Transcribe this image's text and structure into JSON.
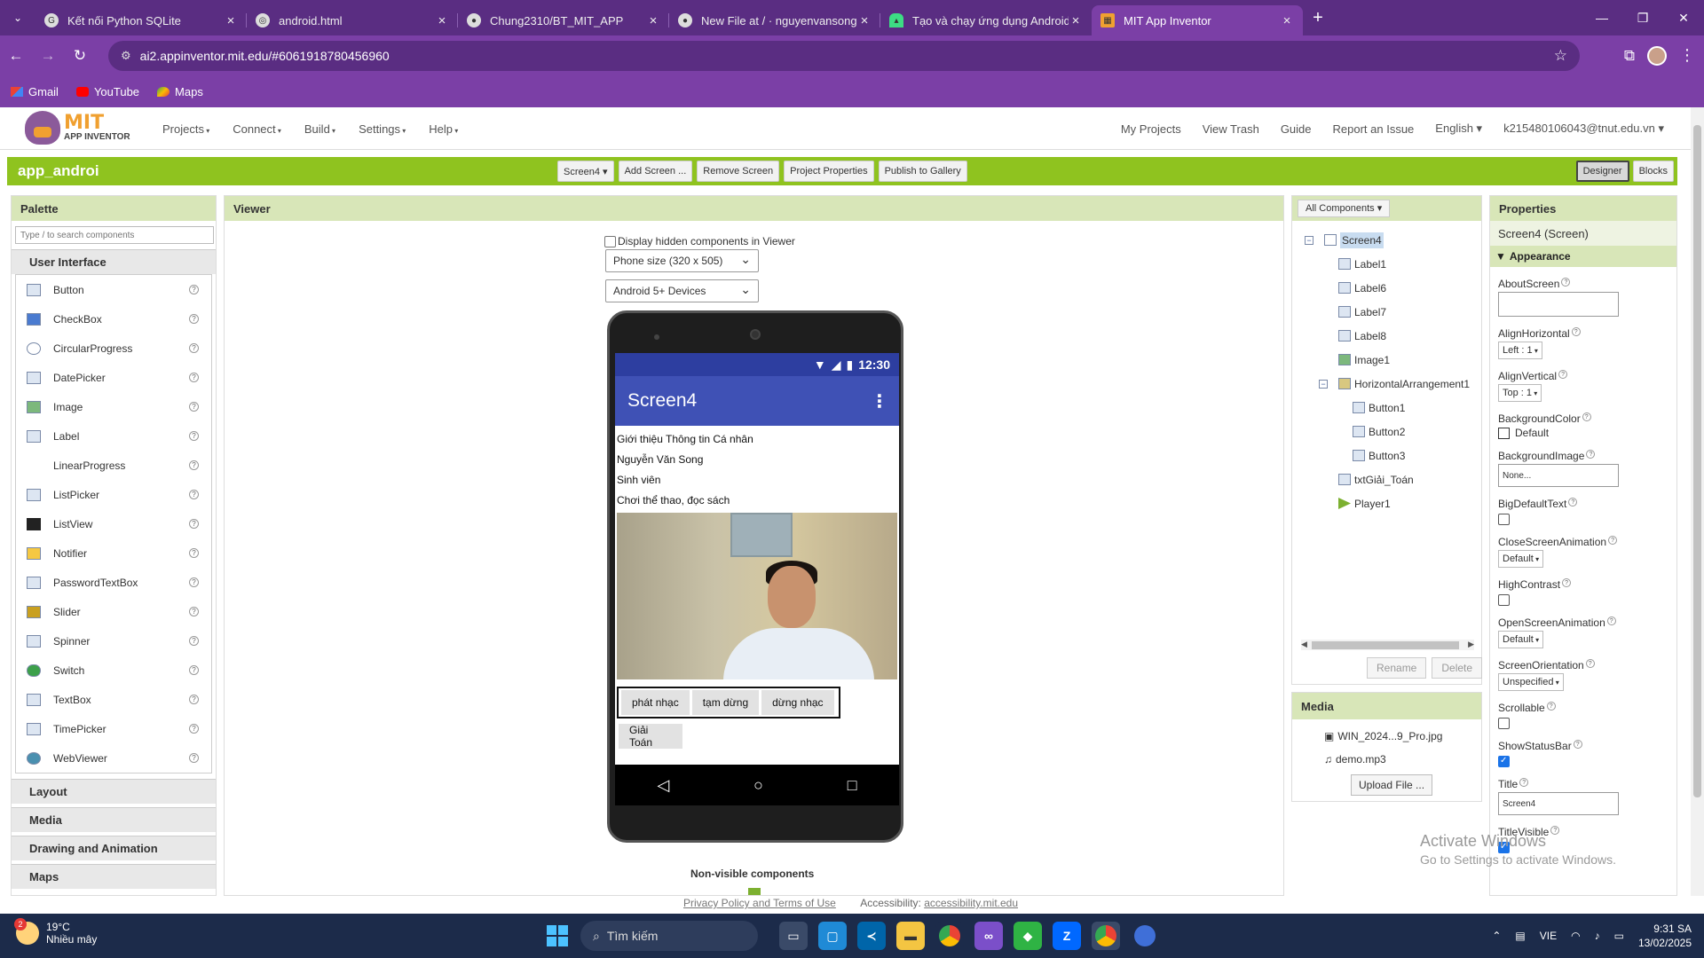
{
  "browser": {
    "tabs": [
      {
        "title": "Kết nối Python SQLite",
        "icon": "google-icon"
      },
      {
        "title": "android.html",
        "icon": "globe-icon"
      },
      {
        "title": "Chung2310/BT_MIT_APP",
        "icon": "github-icon"
      },
      {
        "title": "New File at / · nguyenvansong-",
        "icon": "github-icon"
      },
      {
        "title": "Tạo và chạy ứng dụng Android",
        "icon": "android-icon"
      },
      {
        "title": "MIT App Inventor",
        "icon": "app-inventor-icon"
      }
    ],
    "url": "ai2.appinventor.mit.edu/#6061918780456960",
    "bookmarks": [
      "Gmail",
      "YouTube",
      "Maps"
    ]
  },
  "header": {
    "logo_top": "MIT",
    "logo_bottom": "APP INVENTOR",
    "menu": [
      "Projects",
      "Connect",
      "Build",
      "Settings",
      "Help"
    ],
    "right_menu": [
      "My Projects",
      "View Trash",
      "Guide",
      "Report an Issue",
      "English ▾",
      "k215480106043@tnut.edu.vn ▾"
    ]
  },
  "toolbar": {
    "project_name": "app_androi",
    "screen_select": "Screen4 ▾",
    "buttons": [
      "Add Screen ...",
      "Remove Screen",
      "Project Properties",
      "Publish to Gallery"
    ],
    "designer": "Designer",
    "blocks": "Blocks"
  },
  "palette": {
    "title": "Palette",
    "search_placeholder": "Type / to search components",
    "category_open": "User Interface",
    "components": [
      "Button",
      "CheckBox",
      "CircularProgress",
      "DatePicker",
      "Image",
      "Label",
      "LinearProgress",
      "ListPicker",
      "ListView",
      "Notifier",
      "PasswordTextBox",
      "Slider",
      "Spinner",
      "Switch",
      "TextBox",
      "TimePicker",
      "WebViewer"
    ],
    "categories_closed": [
      "Layout",
      "Media",
      "Drawing and Animation",
      "Maps"
    ]
  },
  "viewer": {
    "title": "Viewer",
    "hidden_label": "Display hidden components in Viewer",
    "size_select": "Phone size (320 x 505)",
    "device_select": "Android 5+ Devices",
    "nonvisible": "Non-visible components",
    "footer_policy": "Privacy Policy and Terms of Use",
    "footer_access_label": "Accessibility: ",
    "footer_access_link": "accessibility.mit.edu"
  },
  "phone": {
    "time": "12:30",
    "title": "Screen4",
    "labels": [
      "Giới thiệu Thông tin Cá nhân",
      "Nguyễn Văn Song",
      "Sinh viên",
      "Chơi thể thao, đọc sách"
    ],
    "buttons": [
      "phát nhạc",
      "tạm dừng",
      "dừng nhạc"
    ],
    "button_solve": "Giải Toán"
  },
  "components": {
    "dropdown": "All Components ▾",
    "tree": [
      {
        "name": "Screen4",
        "depth": 0,
        "toggle": "⊟"
      },
      {
        "name": "Label1",
        "depth": 1
      },
      {
        "name": "Label6",
        "depth": 1
      },
      {
        "name": "Label7",
        "depth": 1
      },
      {
        "name": "Label8",
        "depth": 1
      },
      {
        "name": "Image1",
        "depth": 1
      },
      {
        "name": "HorizontalArrangement1",
        "depth": 1,
        "toggle": "⊟"
      },
      {
        "name": "Button1",
        "depth": 2
      },
      {
        "name": "Button2",
        "depth": 2
      },
      {
        "name": "Button3",
        "depth": 2
      },
      {
        "name": "txtGiải_Toán",
        "depth": 1
      },
      {
        "name": "Player1",
        "depth": 1
      }
    ],
    "rename": "Rename",
    "delete": "Delete"
  },
  "media": {
    "title": "Media",
    "files": [
      "WIN_2024...9_Pro.jpg",
      "demo.mp3"
    ],
    "upload": "Upload File ..."
  },
  "properties": {
    "title": "Properties",
    "screen": "Screen4 (Screen)",
    "section": "Appearance",
    "about": "AboutScreen",
    "align_h": "AlignHorizontal",
    "align_h_val": "Left : 1",
    "align_v": "AlignVertical",
    "align_v_val": "Top : 1",
    "bgcolor": "BackgroundColor",
    "bgcolor_val": "Default",
    "bgimage": "BackgroundImage",
    "bgimage_val": "None...",
    "bigtext": "BigDefaultText",
    "close_anim": "CloseScreenAnimation",
    "close_anim_val": "Default",
    "contrast": "HighContrast",
    "open_anim": "OpenScreenAnimation",
    "open_anim_val": "Default",
    "orientation": "ScreenOrientation",
    "orientation_val": "Unspecified",
    "scrollable": "Scrollable",
    "statusbar": "ShowStatusBar",
    "title_prop": "Title",
    "title_val": "Screen4",
    "title_visible": "TitleVisible"
  },
  "watermark": {
    "line1": "Activate Windows",
    "line2": "Go to Settings to activate Windows."
  },
  "taskbar": {
    "temp": "19°C",
    "weather": "Nhiều mây",
    "weather_badge": "2",
    "search": "Tìm kiếm",
    "lang": "VIE",
    "time": "9:31 SA",
    "date": "13/02/2025"
  },
  "colors": {
    "browser_purple": "#7b3fa6",
    "toolbar_green": "#8fc31f",
    "phone_appbar": "#3f51b5"
  }
}
